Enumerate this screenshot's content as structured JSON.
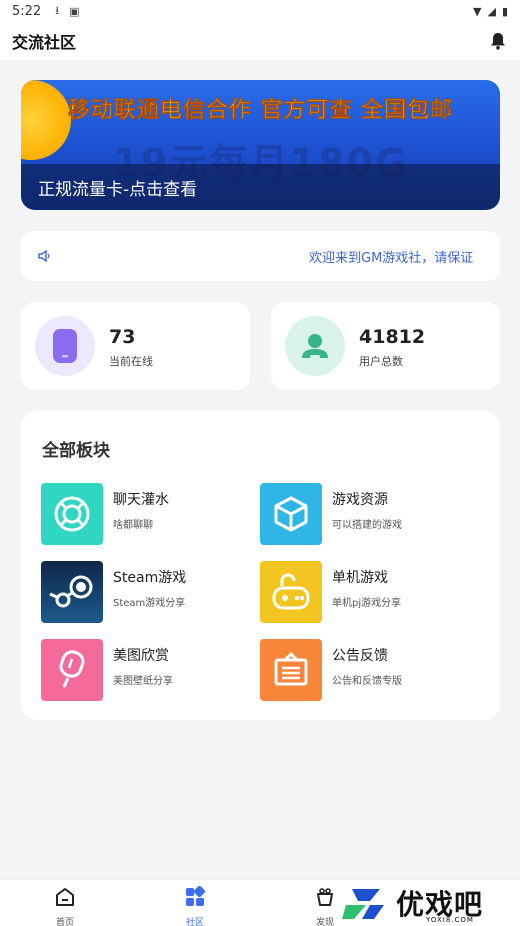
{
  "status_bar": {
    "time": "5:22"
  },
  "header": {
    "title": "交流社区",
    "bell_icon": "bell-icon"
  },
  "banner": {
    "line1": "移动联通电信合作  官方可查  全国包邮",
    "big_text": "19元每月180G",
    "caption": "正规流量卡-点击查看"
  },
  "notice": {
    "text": "欢迎来到GM游戏社，请保证"
  },
  "stats": [
    {
      "value": "73",
      "label": "当前在线",
      "icon": "phone-icon",
      "color": "#8b6cf0"
    },
    {
      "value": "41812",
      "label": "用户总数",
      "icon": "user-icon",
      "color": "#35b58a"
    }
  ],
  "boards": {
    "heading": "全部板块",
    "items": [
      {
        "name": "聊天灌水",
        "desc": "啥都聊聊",
        "icon": "lifebuoy-icon",
        "color": "#2fd7c3"
      },
      {
        "name": "游戏资源",
        "desc": "可以搭建的游戏",
        "icon": "cube-icon",
        "color": "#2fb6e6"
      },
      {
        "name": "Steam游戏",
        "desc": "Steam游戏分享",
        "icon": "steam-icon",
        "color": "#163a66"
      },
      {
        "name": "单机游戏",
        "desc": "单机pj游戏分享",
        "icon": "gamepad-icon",
        "color": "#f2c520"
      },
      {
        "name": "美图欣赏",
        "desc": "美图壁纸分享",
        "icon": "popsicle-icon",
        "color": "#f46a9b"
      },
      {
        "name": "公告反馈",
        "desc": "公告和反馈专版",
        "icon": "notice-board-icon",
        "color": "#f7853a"
      }
    ]
  },
  "tabs": [
    {
      "label": "首页",
      "icon": "home-icon"
    },
    {
      "label": "社区",
      "icon": "community-icon",
      "active": true
    },
    {
      "label": "发现",
      "icon": "discover-icon"
    }
  ],
  "watermark": {
    "text": "优戏吧",
    "url": "YOXI8.COM"
  }
}
